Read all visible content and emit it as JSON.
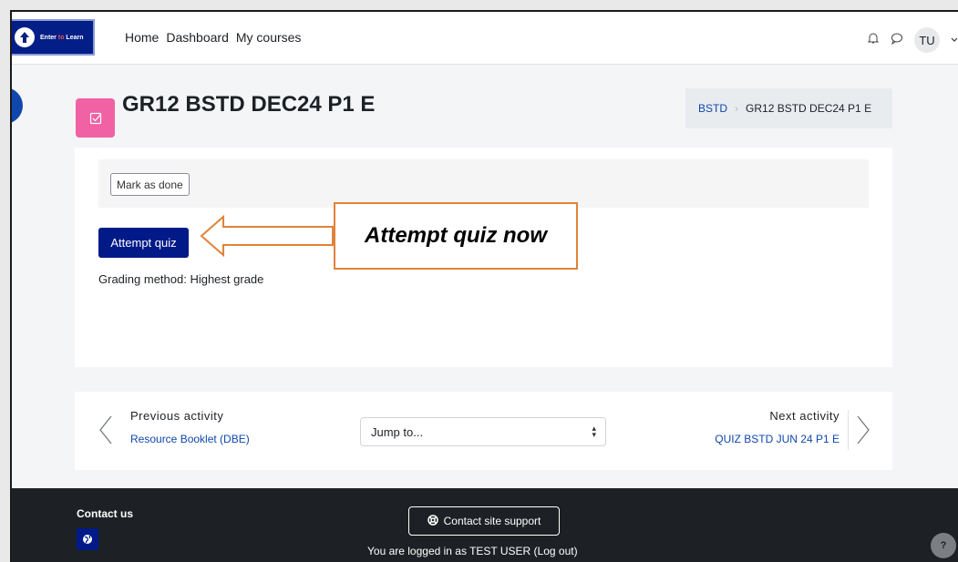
{
  "brand": {
    "text_main": "Enter",
    "text_to": "to",
    "text_learn": "Learn"
  },
  "nav": {
    "links": [
      "Home",
      "Dashboard",
      "My courses"
    ],
    "avatar_initials": "TU"
  },
  "page": {
    "title": "GR12 BSTD DEC24 P1 E"
  },
  "breadcrumb": {
    "course": "BSTD",
    "current": "GR12 BSTD DEC24 P1 E"
  },
  "activity": {
    "mark_done_label": "Mark as done",
    "attempt_label": "Attempt quiz",
    "grading_method": "Grading method: Highest grade"
  },
  "callout": {
    "text": "Attempt quiz now",
    "border_color": "#e0833a"
  },
  "activity_nav": {
    "previous_label": "Previous activity",
    "previous_link": "Resource Booklet (DBE)",
    "jump_placeholder": "Jump to...",
    "next_label": "Next activity",
    "next_link": "QUIZ BSTD JUN 24 P1 E"
  },
  "footer": {
    "contact_us": "Contact us",
    "support_label": "Contact site support",
    "logged_in_text": "You are logged in as TEST USER (Log out)",
    "help_label": "?"
  },
  "colors": {
    "primary": "#011a88",
    "link": "#0f47ad",
    "quiz_icon": "#f062a4",
    "footer_bg": "#1d2125"
  }
}
